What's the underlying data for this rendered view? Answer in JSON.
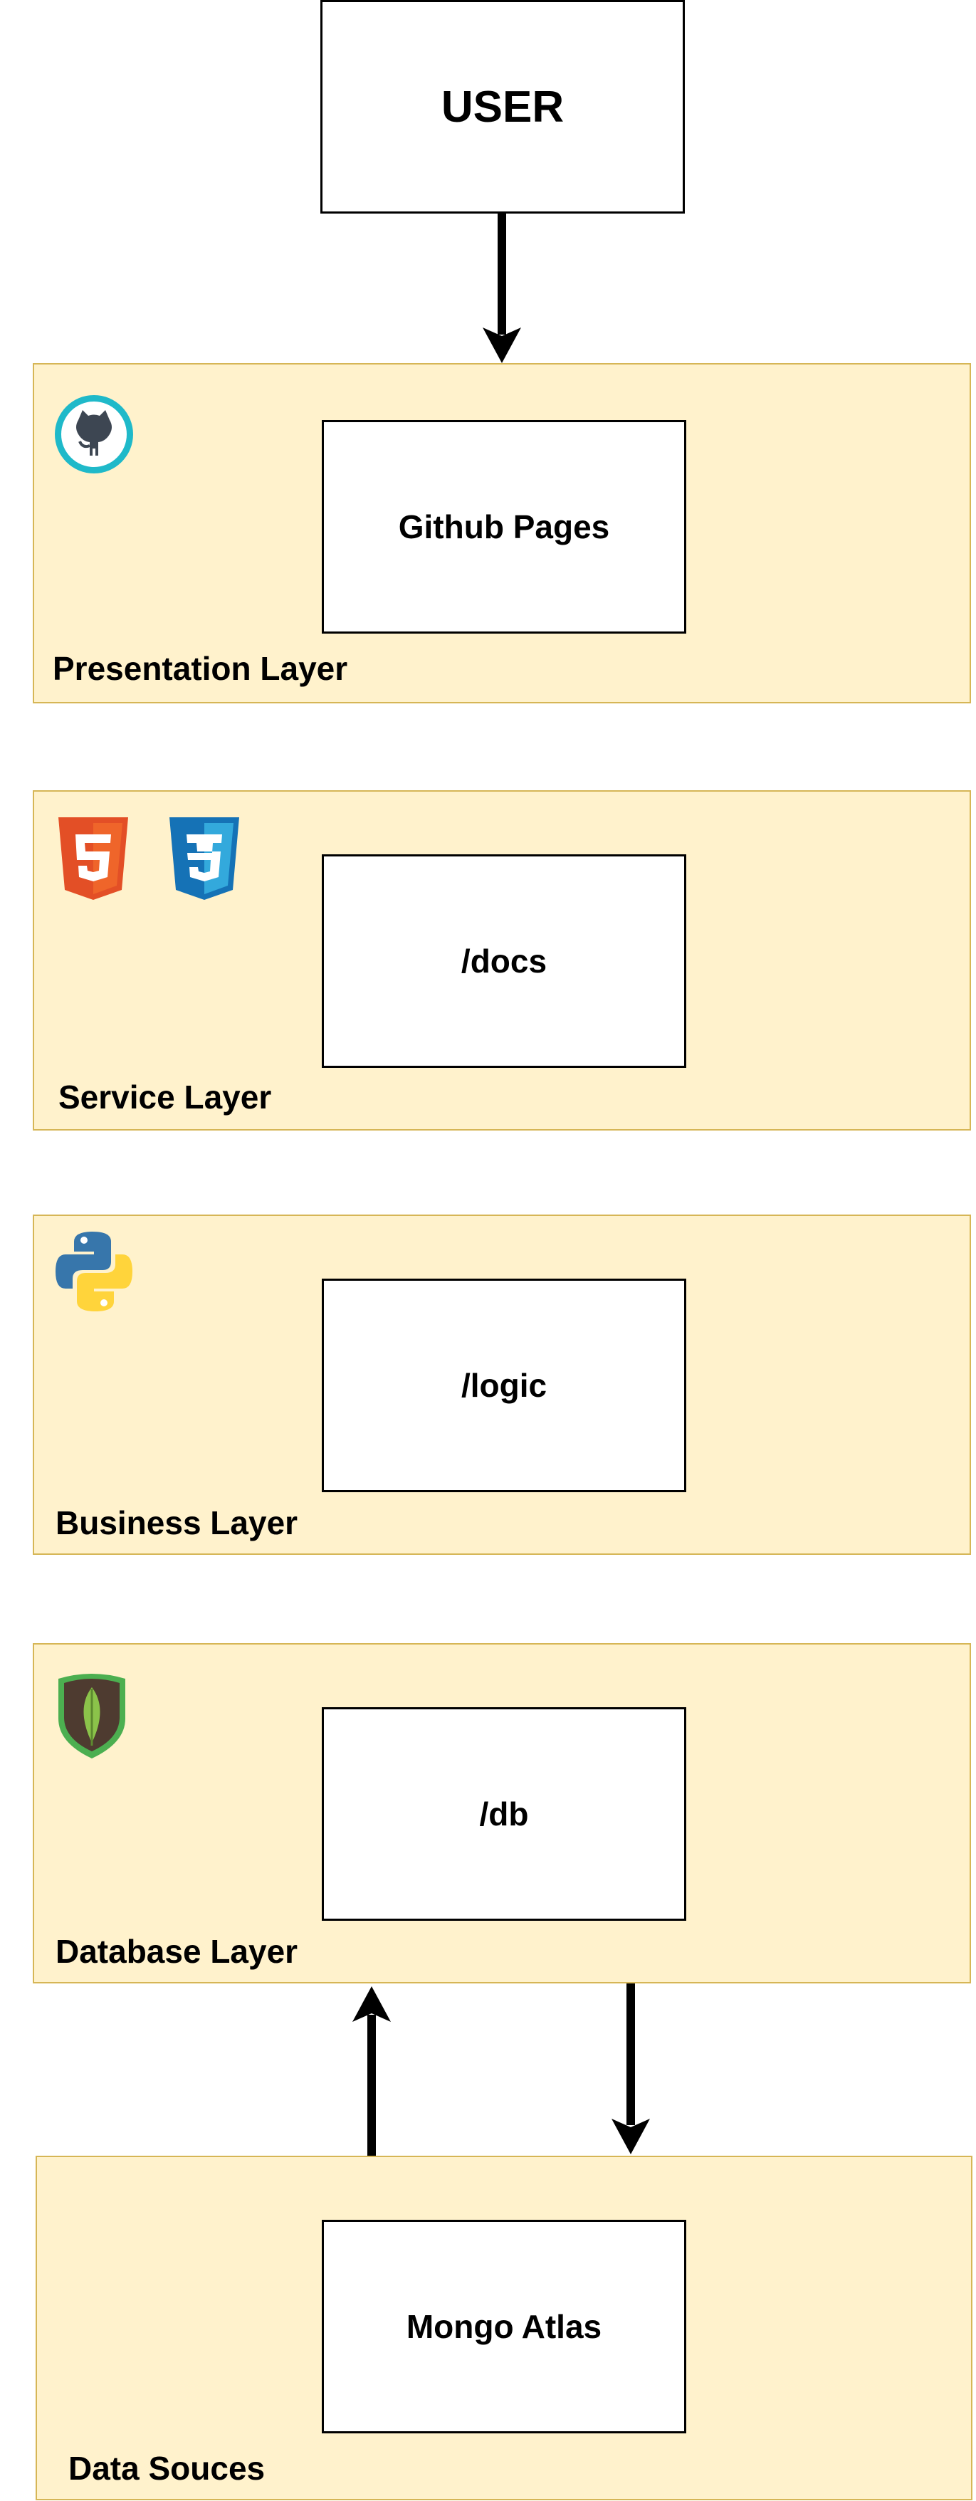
{
  "user_box": {
    "label": "USER"
  },
  "layers": [
    {
      "name": "Presentation Layer",
      "component": "Github Pages",
      "icons": [
        "github-icon"
      ]
    },
    {
      "name": "Service Layer",
      "component": "/docs",
      "icons": [
        "html5-icon",
        "css3-icon"
      ]
    },
    {
      "name": "Business Layer",
      "component": "/logic",
      "icons": [
        "python-icon"
      ]
    },
    {
      "name": "Database Layer",
      "component": "/db",
      "icons": [
        "mongodb-leaf-icon"
      ]
    },
    {
      "name": "Data Souces",
      "component": "Mongo Atlas",
      "icons": []
    }
  ],
  "connections": [
    {
      "from": "USER",
      "to": "Presentation Layer"
    },
    {
      "from": "Data Souces",
      "to": "Database Layer"
    },
    {
      "from": "Database Layer",
      "to": "Data Souces"
    }
  ],
  "colors": {
    "layer_fill": "#fff2cc",
    "layer_border": "#d6b656",
    "box_fill": "#ffffff",
    "line": "#000000"
  }
}
